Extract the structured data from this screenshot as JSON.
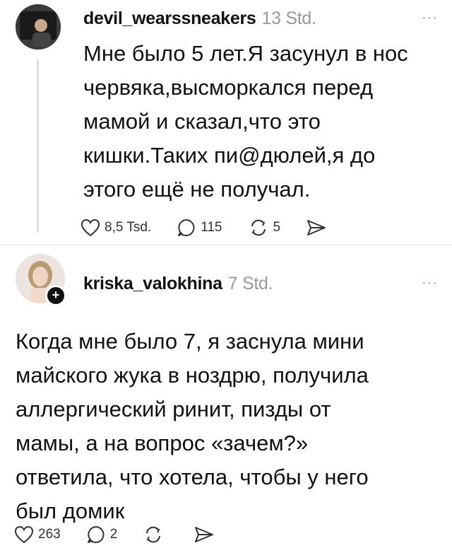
{
  "posts": [
    {
      "username": "devil_wearssneakers",
      "time": "13 Std.",
      "more": "···",
      "lines": [
        "Мне было 5 лет.Я засунул в нос",
        "червяка,высморкался перед",
        "мамой и сказал,что это",
        "кишки.Таких пи@дюлей,я до",
        "этого ещё не получал."
      ],
      "likes": "8,5 Tsd.",
      "comments": "115",
      "reposts": "5"
    },
    {
      "username": "kriska_valokhina",
      "time": "7 Std.",
      "more": "···",
      "follow": "+",
      "lines": [
        "Когда мне было 7, я заснула мини",
        "майского жука в ноздрю, получила",
        "аллергический ринит, пизды от",
        "мамы, а на вопрос «зачем?»",
        "ответила, что хотела, чтобы у него",
        "был домик"
      ],
      "likes": "263",
      "comments": "2",
      "reposts": ""
    }
  ]
}
